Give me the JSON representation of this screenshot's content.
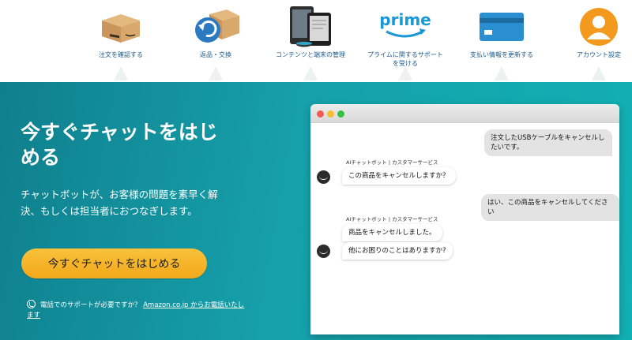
{
  "nav": [
    {
      "id": "orders",
      "label": "注文を確認する",
      "icon": "package-icon"
    },
    {
      "id": "returns",
      "label": "返品・交換",
      "icon": "return-package-icon"
    },
    {
      "id": "content",
      "label": "コンテンツと端末の管理",
      "icon": "devices-icon"
    },
    {
      "id": "prime",
      "label": "プライムに関するサポートを受ける",
      "icon": "prime-logo-icon",
      "logo_text": "prime"
    },
    {
      "id": "payment",
      "label": "支払い情報を更新する",
      "icon": "credit-card-icon"
    },
    {
      "id": "account",
      "label": "アカウント設定",
      "icon": "account-avatar-icon"
    }
  ],
  "hero": {
    "title": "今すぐチャットをはじめる",
    "subtitle": "チャットボットが、お客様の問題を素早く解決、もしくは担当者におつなぎします。",
    "cta_label": "今すぐチャットをはじめる",
    "phone_text": "電話でのサポートが必要ですか？",
    "phone_link": "Amazon.co.jp からお電話いたします"
  },
  "chat": {
    "bot_label": "AIチャットボット | カスタマーサービス",
    "messages": [
      {
        "from": "user",
        "text": "注文したUSBケーブルをキャンセルしたいです。"
      },
      {
        "from": "bot",
        "text": "この商品をキャンセルしますか？"
      },
      {
        "from": "user",
        "text": "はい、この商品をキャンセルしてください"
      },
      {
        "from": "bot",
        "text": "商品をキャンセルしました。"
      },
      {
        "from": "bot",
        "text": "他にお困りのことはありますか?"
      }
    ]
  },
  "colors": {
    "hero_start": "#0f7f8d",
    "hero_end": "#11b0b4",
    "cta": "#f2a81a",
    "link_blue": "#1d5a8b",
    "prime_blue": "#1a98d5",
    "account_orange": "#f39a1e"
  }
}
